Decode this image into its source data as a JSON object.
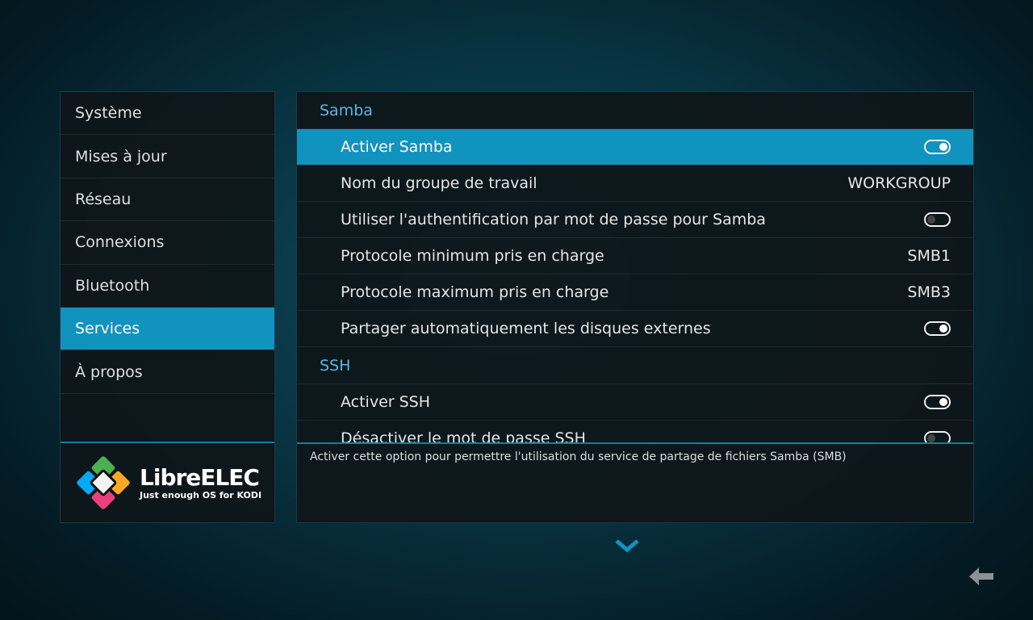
{
  "menu": [
    {
      "label": "Système"
    },
    {
      "label": "Mises à jour"
    },
    {
      "label": "Réseau"
    },
    {
      "label": "Connexions"
    },
    {
      "label": "Bluetooth"
    },
    {
      "label": "Services",
      "active": true
    },
    {
      "label": "À propos"
    }
  ],
  "logo": {
    "name": "LibreELEC",
    "tagline": "Just enough OS for KODI",
    "colors": [
      "#4caf50",
      "#f9a825",
      "#03a9f4",
      "#ec407a"
    ]
  },
  "sections": [
    {
      "title": "Samba",
      "rows": [
        {
          "label": "Activer Samba",
          "type": "toggle",
          "value": true,
          "active": true
        },
        {
          "label": "Nom du groupe de travail",
          "type": "text",
          "value": "WORKGROUP"
        },
        {
          "label": "Utiliser l'authentification par mot de passe pour Samba",
          "type": "toggle",
          "value": false
        },
        {
          "label": "Protocole minimum pris en charge",
          "type": "text",
          "value": "SMB1"
        },
        {
          "label": "Protocole maximum pris en charge",
          "type": "text",
          "value": "SMB3"
        },
        {
          "label": "Partager automatiquement les disques externes",
          "type": "toggle",
          "value": true
        }
      ]
    },
    {
      "title": "SSH",
      "rows": [
        {
          "label": "Activer SSH",
          "type": "toggle",
          "value": true
        },
        {
          "label": "Désactiver le mot de passe SSH",
          "type": "toggle",
          "value": false
        }
      ]
    }
  ],
  "description": "Activer cette option pour permettre l'utilisation du service de partage de fichiers Samba (SMB)",
  "accent": "#1193c0"
}
